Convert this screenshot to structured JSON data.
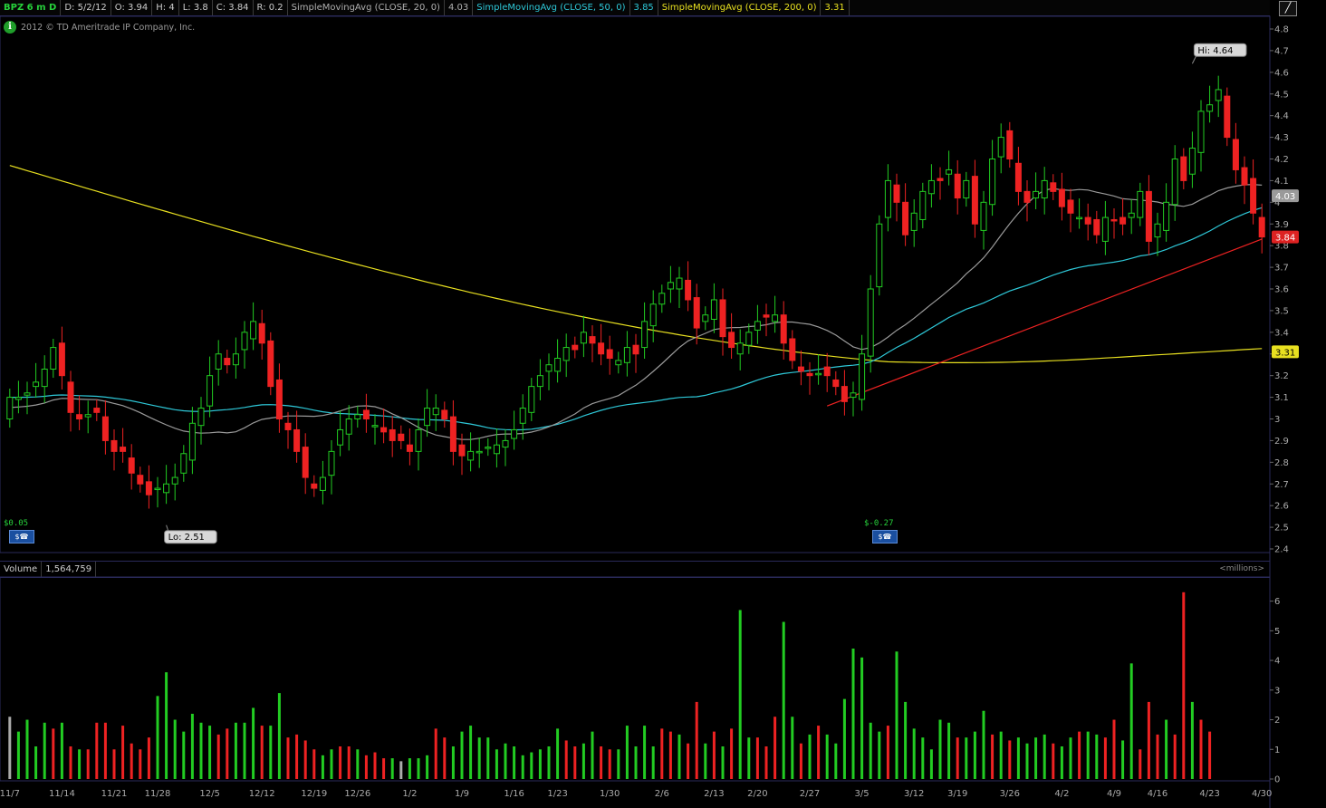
{
  "header": {
    "symbol": "BPZ 6 m D",
    "date": "D: 5/2/12",
    "open": "O: 3.94",
    "high": "H: 4",
    "low": "L: 3.8",
    "close": "C: 3.84",
    "range": "R: 0.2",
    "sma20_label": "SimpleMovingAvg (CLOSE, 20, 0)",
    "sma20_value": "4.03",
    "sma50_label": "SimpleMovingAvg (CLOSE, 50, 0)",
    "sma50_value": "3.85",
    "sma200_label": "SimpleMovingAvg (CLOSE, 200, 0)",
    "sma200_value": "3.31"
  },
  "copyright": "2012 © TD Ameritrade IP Company, Inc.",
  "earnings": [
    {
      "label": "$0.05",
      "icon": "earnings-icon"
    },
    {
      "label": "$-0.27",
      "icon": "earnings-icon"
    }
  ],
  "volume_header": {
    "label": "Volume",
    "value": "1,564,759",
    "units": "<millions>"
  },
  "colors": {
    "up": "#22cc22",
    "down": "#ee2222",
    "sma20": "#9a9a9a",
    "sma50": "#2ec8d8",
    "sma200": "#e8e020",
    "trend": "#ee2222"
  },
  "chart_data": {
    "type": "candlestick",
    "price_ylim": [
      2.4,
      4.8
    ],
    "price_ticks": [
      "4.8",
      "4.7",
      "4.6",
      "4.5",
      "4.4",
      "4.3",
      "4.2",
      "4.1",
      "4",
      "3.9",
      "3.8",
      "3.7",
      "3.6",
      "3.5",
      "3.4",
      "3.3",
      "3.2",
      "3.1",
      "3",
      "2.9",
      "2.8",
      "2.7",
      "2.6",
      "2.5",
      "2.4"
    ],
    "volume_ylim": [
      0,
      6.6
    ],
    "volume_ticks": [
      "6",
      "5",
      "4",
      "3",
      "2",
      "1",
      "0"
    ],
    "x_labels": [
      "11/7",
      "11/14",
      "11/21",
      "11/28",
      "12/5",
      "12/12",
      "12/19",
      "12/26",
      "1/2",
      "1/9",
      "1/16",
      "1/23",
      "1/30",
      "2/6",
      "2/13",
      "2/20",
      "2/27",
      "3/5",
      "3/12",
      "3/19",
      "3/26",
      "4/2",
      "4/9",
      "4/16",
      "4/23",
      "4/30"
    ],
    "hi_label": "Hi: 4.64",
    "lo_label": "Lo: 2.51",
    "hi": 4.64,
    "lo": 2.51,
    "last_labels": {
      "sma20": "4.03",
      "close": "3.84",
      "sma200": "3.31"
    },
    "closes": [
      3.1,
      3.1,
      3.12,
      3.17,
      3.23,
      3.33,
      3.2,
      3.03,
      3.0,
      3.02,
      3.03,
      2.9,
      2.85,
      2.85,
      2.75,
      2.7,
      2.65,
      2.68,
      2.7,
      2.73,
      2.84,
      2.98,
      3.05,
      3.2,
      3.3,
      3.25,
      3.3,
      3.4,
      3.45,
      3.35,
      3.15,
      3.0,
      2.95,
      2.85,
      2.73,
      2.68,
      2.73,
      2.85,
      2.95,
      3.0,
      3.02,
      3.0,
      2.97,
      2.94,
      2.9,
      2.9,
      2.85,
      2.95,
      3.05,
      3.05,
      3.0,
      2.85,
      2.83,
      2.85,
      2.85,
      2.87,
      2.88,
      2.9,
      2.95,
      3.05,
      3.15,
      3.2,
      3.25,
      3.28,
      3.33,
      3.32,
      3.4,
      3.35,
      3.3,
      3.28,
      3.27,
      3.33,
      3.3,
      3.45,
      3.53,
      3.58,
      3.63,
      3.65,
      3.55,
      3.42,
      3.48,
      3.55,
      3.38,
      3.33,
      3.35,
      3.4,
      3.45,
      3.47,
      3.48,
      3.35,
      3.27,
      3.22,
      3.2,
      3.21,
      3.2,
      3.15,
      3.08,
      3.12,
      3.3,
      3.6,
      3.9,
      4.1,
      4.0,
      3.85,
      3.95,
      4.05,
      4.1,
      4.1,
      4.15,
      4.02,
      4.1,
      3.9,
      4.0,
      4.2,
      4.3,
      4.2,
      4.05,
      4.0,
      4.05,
      4.1,
      4.05,
      3.98,
      3.95,
      3.93,
      3.9,
      3.85,
      3.93,
      3.92,
      3.9,
      3.95,
      4.05,
      3.82,
      3.9,
      4.0,
      4.2,
      4.1,
      4.25,
      4.42,
      4.45,
      4.52,
      4.3,
      4.15,
      4.08,
      3.95,
      3.84
    ],
    "volumes": [
      2.1,
      1.6,
      2.0,
      1.1,
      1.9,
      1.7,
      1.9,
      1.1,
      1.0,
      1.0,
      1.9,
      1.9,
      1.0,
      1.8,
      1.2,
      1.0,
      1.4,
      2.8,
      3.6,
      2.0,
      1.6,
      2.2,
      1.9,
      1.8,
      1.5,
      1.7,
      1.9,
      1.9,
      2.4,
      1.8,
      1.8,
      2.9,
      1.4,
      1.5,
      1.3,
      1.0,
      0.8,
      1.0,
      1.1,
      1.1,
      1.0,
      0.8,
      0.9,
      0.7,
      0.7,
      0.6,
      0.7,
      0.7,
      0.8,
      1.7,
      1.4,
      1.1,
      1.6,
      1.8,
      1.4,
      1.4,
      1.0,
      1.2,
      1.1,
      0.8,
      0.9,
      1.0,
      1.1,
      1.7,
      1.3,
      1.1,
      1.2,
      1.6,
      1.1,
      1.0,
      1.0,
      1.8,
      1.1,
      1.8,
      1.1,
      1.7,
      1.6,
      1.5,
      1.2,
      2.6,
      1.2,
      1.6,
      1.1,
      1.7,
      5.7,
      1.4,
      1.4,
      1.1,
      2.1,
      5.3,
      2.1,
      1.2,
      1.5,
      1.8,
      1.5,
      1.2,
      2.7,
      4.4,
      4.1,
      1.9,
      1.6,
      1.8,
      4.3,
      2.6,
      1.7,
      1.4,
      1.0,
      2.0,
      1.9,
      1.4,
      1.4,
      1.6,
      2.3,
      1.5,
      1.6,
      1.3,
      1.4,
      1.2,
      1.4,
      1.5,
      1.2,
      1.1,
      1.4,
      1.6,
      1.6,
      1.5,
      1.4,
      2.0,
      1.3,
      3.9,
      1.0,
      2.6,
      1.5,
      2.0,
      1.5,
      6.3,
      2.6,
      2.0,
      1.6
    ],
    "volume_up": [
      2,
      1,
      1,
      1,
      1,
      0,
      1,
      0,
      1,
      0,
      0,
      0,
      0,
      0,
      0,
      0,
      0,
      1,
      1,
      1,
      1,
      1,
      1,
      1,
      0,
      0,
      1,
      1,
      1,
      0,
      1,
      1,
      0,
      0,
      0,
      0,
      1,
      1,
      0,
      0,
      1,
      0,
      0,
      0,
      1,
      2,
      1,
      1,
      1,
      0,
      0,
      1,
      1,
      1,
      1,
      1,
      1,
      1,
      1,
      1,
      1,
      1,
      1,
      1,
      0,
      0,
      1,
      1,
      0,
      0,
      1,
      1,
      1,
      1,
      1,
      0,
      0,
      1,
      0,
      0,
      1,
      0,
      1,
      0,
      1,
      1,
      0,
      0,
      0,
      1,
      1,
      0,
      1,
      0,
      1,
      1,
      1,
      1,
      1,
      1,
      1,
      0,
      1,
      1,
      1,
      1,
      1,
      1,
      1,
      0,
      1,
      1,
      1,
      0,
      1,
      0,
      1,
      1,
      1,
      1,
      0,
      1,
      1,
      0,
      1,
      1,
      0,
      0,
      1,
      1,
      0,
      0,
      0,
      1,
      0,
      0,
      1,
      0,
      0,
      0,
      0,
      0,
      0,
      1,
      0,
      1
    ]
  }
}
